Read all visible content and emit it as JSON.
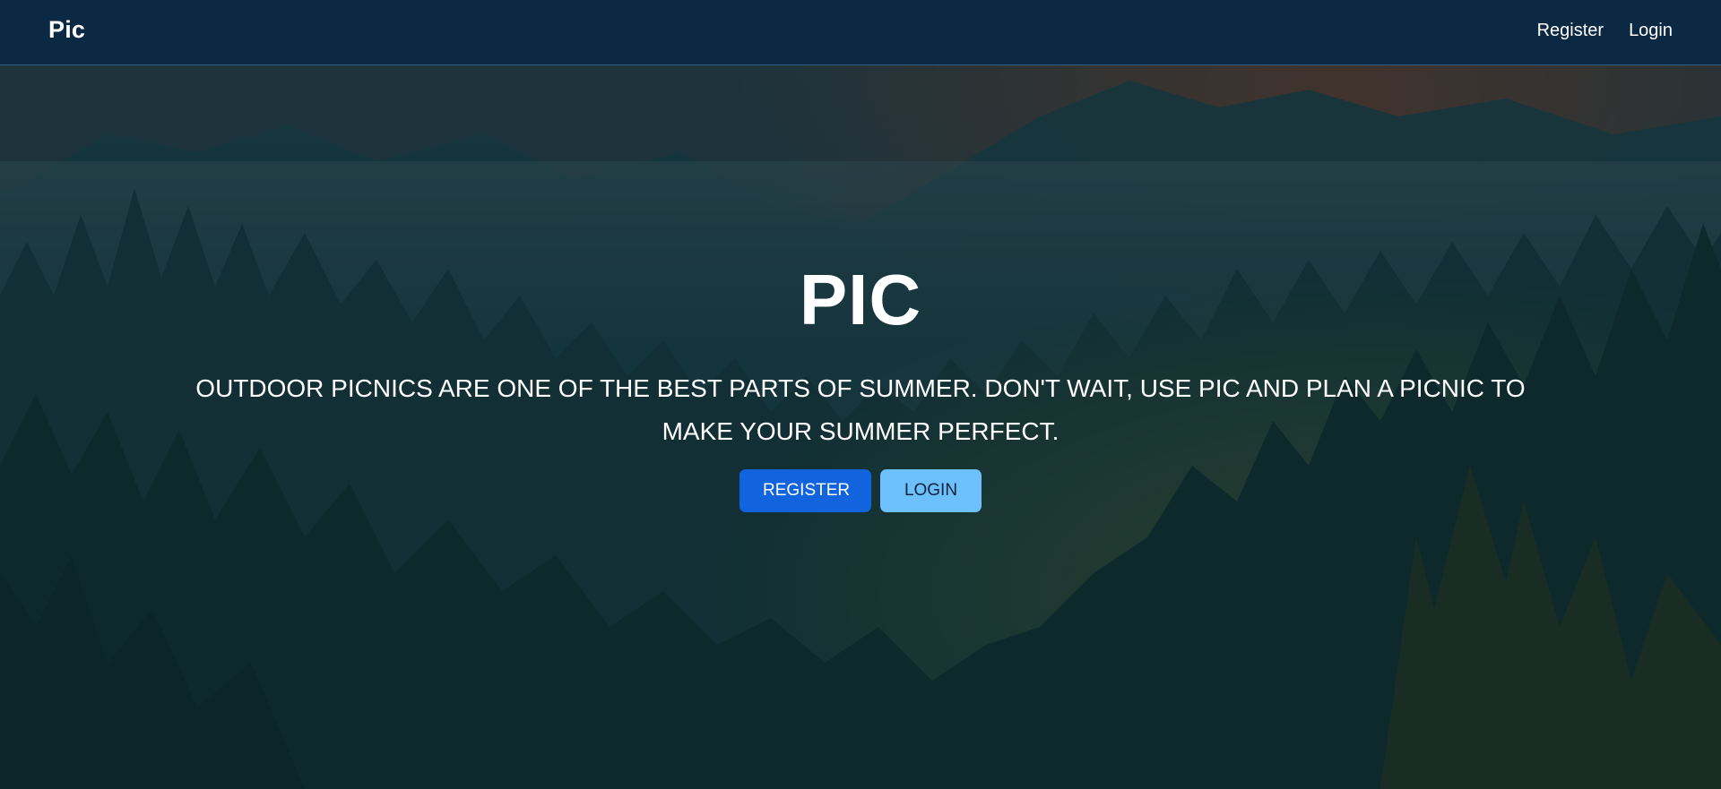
{
  "navbar": {
    "brand": "Pic",
    "links": [
      {
        "label": "Register"
      },
      {
        "label": "Login"
      }
    ]
  },
  "hero": {
    "title": "PIC",
    "subtitle": "OUTDOOR PICNICS ARE ONE OF THE BEST PARTS OF SUMMER. DON'T WAIT, USE PIC AND PLAN A PICNIC TO MAKE YOUR SUMMER PERFECT.",
    "buttons": {
      "register_label": "REGISTER",
      "login_label": "LOGIN"
    }
  },
  "colors": {
    "navbar_bg": "#0c2944",
    "register_button": "#1163de",
    "login_button": "#6cc0fb",
    "text": "#ffffff"
  },
  "background": {
    "icon": "forest-mountain-photo"
  }
}
